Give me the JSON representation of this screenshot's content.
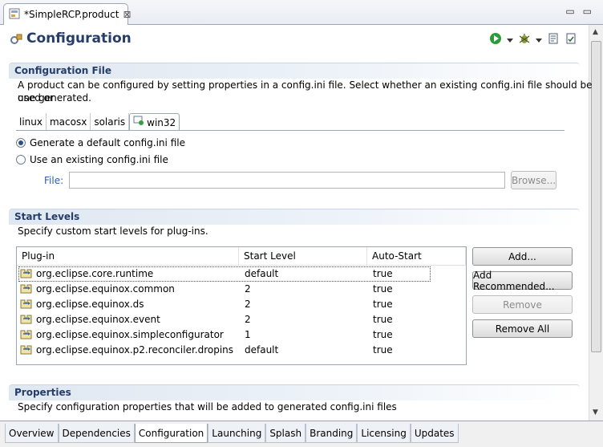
{
  "editor_tab": {
    "title": "*SimpleRCP.product",
    "close": "⊠"
  },
  "window_buttons": {
    "minimize": "▭",
    "maximize": "▭"
  },
  "header": {
    "title": "Configuration"
  },
  "config_file": {
    "title": "Configuration File",
    "description_line1": "A product can be configured by setting properties in a config.ini file.  Select whether an existing config.ini file should be used or",
    "description_line2": "one generated.",
    "os_tabs": [
      "linux",
      "macosx",
      "solaris",
      "win32"
    ],
    "active_os_tab": "win32",
    "radio_generate": "Generate a default config.ini file",
    "radio_existing": "Use an existing config.ini file",
    "selected_radio": "generate",
    "file_label": "File:",
    "file_value": "",
    "browse_label": "Browse..."
  },
  "start_levels": {
    "title": "Start Levels",
    "description": "Specify custom start levels for plug-ins.",
    "columns": [
      "Plug-in",
      "Start Level",
      "Auto-Start"
    ],
    "rows": [
      {
        "plugin": "org.eclipse.core.runtime",
        "level": "default",
        "auto": "true"
      },
      {
        "plugin": "org.eclipse.equinox.common",
        "level": "2",
        "auto": "true"
      },
      {
        "plugin": "org.eclipse.equinox.ds",
        "level": "2",
        "auto": "true"
      },
      {
        "plugin": "org.eclipse.equinox.event",
        "level": "2",
        "auto": "true"
      },
      {
        "plugin": "org.eclipse.equinox.simpleconfigurator",
        "level": "1",
        "auto": "true"
      },
      {
        "plugin": "org.eclipse.equinox.p2.reconciler.dropins",
        "level": "default",
        "auto": "true"
      }
    ],
    "buttons": {
      "add": "Add...",
      "add_recommended": "Add Recommended...",
      "remove": "Remove",
      "remove_all": "Remove All"
    }
  },
  "properties": {
    "title": "Properties",
    "description": "Specify configuration properties that will be added to generated config.ini files"
  },
  "page_tabs": [
    "Overview",
    "Dependencies",
    "Configuration",
    "Launching",
    "Splash",
    "Branding",
    "Licensing",
    "Updates"
  ],
  "active_page_tab": "Configuration",
  "colors": {
    "section_title": "#243d6a",
    "link_label": "#2a5db0",
    "run_green": "#2e9b3a"
  }
}
